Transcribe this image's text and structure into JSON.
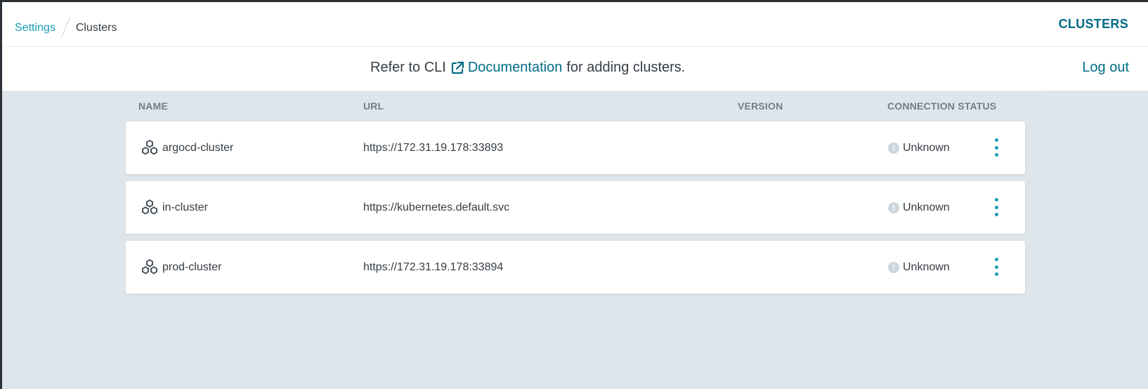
{
  "breadcrumb": {
    "parent": "Settings",
    "current": "Clusters"
  },
  "page_title": "CLUSTERS",
  "notice": {
    "prefix": "Refer to CLI",
    "link": "Documentation",
    "suffix": "for adding clusters."
  },
  "logout_label": "Log out",
  "table": {
    "headers": {
      "name": "NAME",
      "url": "URL",
      "version": "VERSION",
      "status": "CONNECTION STATUS"
    },
    "rows": [
      {
        "name": "argocd-cluster",
        "url": "https://172.31.19.178:33893",
        "version": "",
        "status": "Unknown"
      },
      {
        "name": "in-cluster",
        "url": "https://kubernetes.default.svc",
        "version": "",
        "status": "Unknown"
      },
      {
        "name": "prod-cluster",
        "url": "https://172.31.19.178:33894",
        "version": "",
        "status": "Unknown"
      }
    ]
  },
  "icons": {
    "cluster": "cluster-icon",
    "external_link": "external-link-icon",
    "status": "info-circle-icon",
    "menu": "more-vertical-icon"
  },
  "colors": {
    "accent": "#006b85",
    "link": "#1a9bb4",
    "background": "#dee6eb",
    "status_unknown": "#ccd6dd"
  }
}
